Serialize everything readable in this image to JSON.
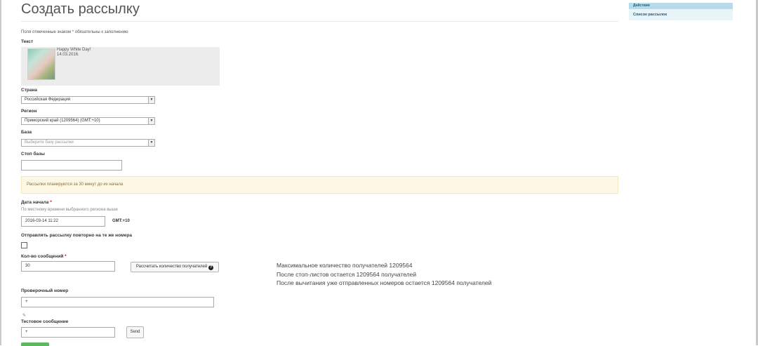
{
  "page": {
    "title": "Создать рассылку"
  },
  "form": {
    "required_note": "Поля отмеченные знаком * обязательны к заполнению",
    "text": {
      "label": "Текст",
      "preview_line1": "Happy White Day!",
      "preview_line2": "14.03.2016."
    },
    "country": {
      "label": "Страна",
      "value": "Российская Федерация"
    },
    "region": {
      "label": "Регион",
      "value": "Приморский край (1209564) (GMT:+10)"
    },
    "base": {
      "label": "База",
      "placeholder": "Выберите базу рассылки"
    },
    "stop_base": {
      "label": "Стоп базы",
      "value": ""
    },
    "alert": "Рассылки планируются за 30 минут до их начала",
    "start_date": {
      "label": "Дата начала",
      "required_mark": "*",
      "hint": "По местному времени выбранного региона выше",
      "value": "2016-03-14 11:22",
      "timezone": "GMT:+10"
    },
    "repeat": {
      "label": "Отправлять рассылку повторно на те же номера",
      "checked": false
    },
    "count": {
      "label": "Кол-во сообщений",
      "required_mark": "*",
      "value": "30",
      "calc_button": "Рассчитать количество получателей",
      "help_icon": "question-circle-icon"
    },
    "recipients_info": {
      "line1": "Максимальное количество получателей 1209564",
      "line2": "После стоп-листов остается 1209564 получателей",
      "line3": "После вычитания уже отправленных номеров остается 1209564 получателей"
    },
    "check_number": {
      "label": "Проверочный номер",
      "value": "+"
    },
    "test_message": {
      "label": "Тестовое сообщение",
      "value": "+",
      "send_button": "Send"
    }
  },
  "sidebar": {
    "header": "Действия",
    "items": [
      {
        "label": "Список рассылок"
      }
    ]
  },
  "colors": {
    "alert_bg": "#fcf8e3",
    "sidebar_header": "#b8dbea",
    "sidebar_bg": "#e8f4f8",
    "submit_green": "#5cb85c"
  }
}
